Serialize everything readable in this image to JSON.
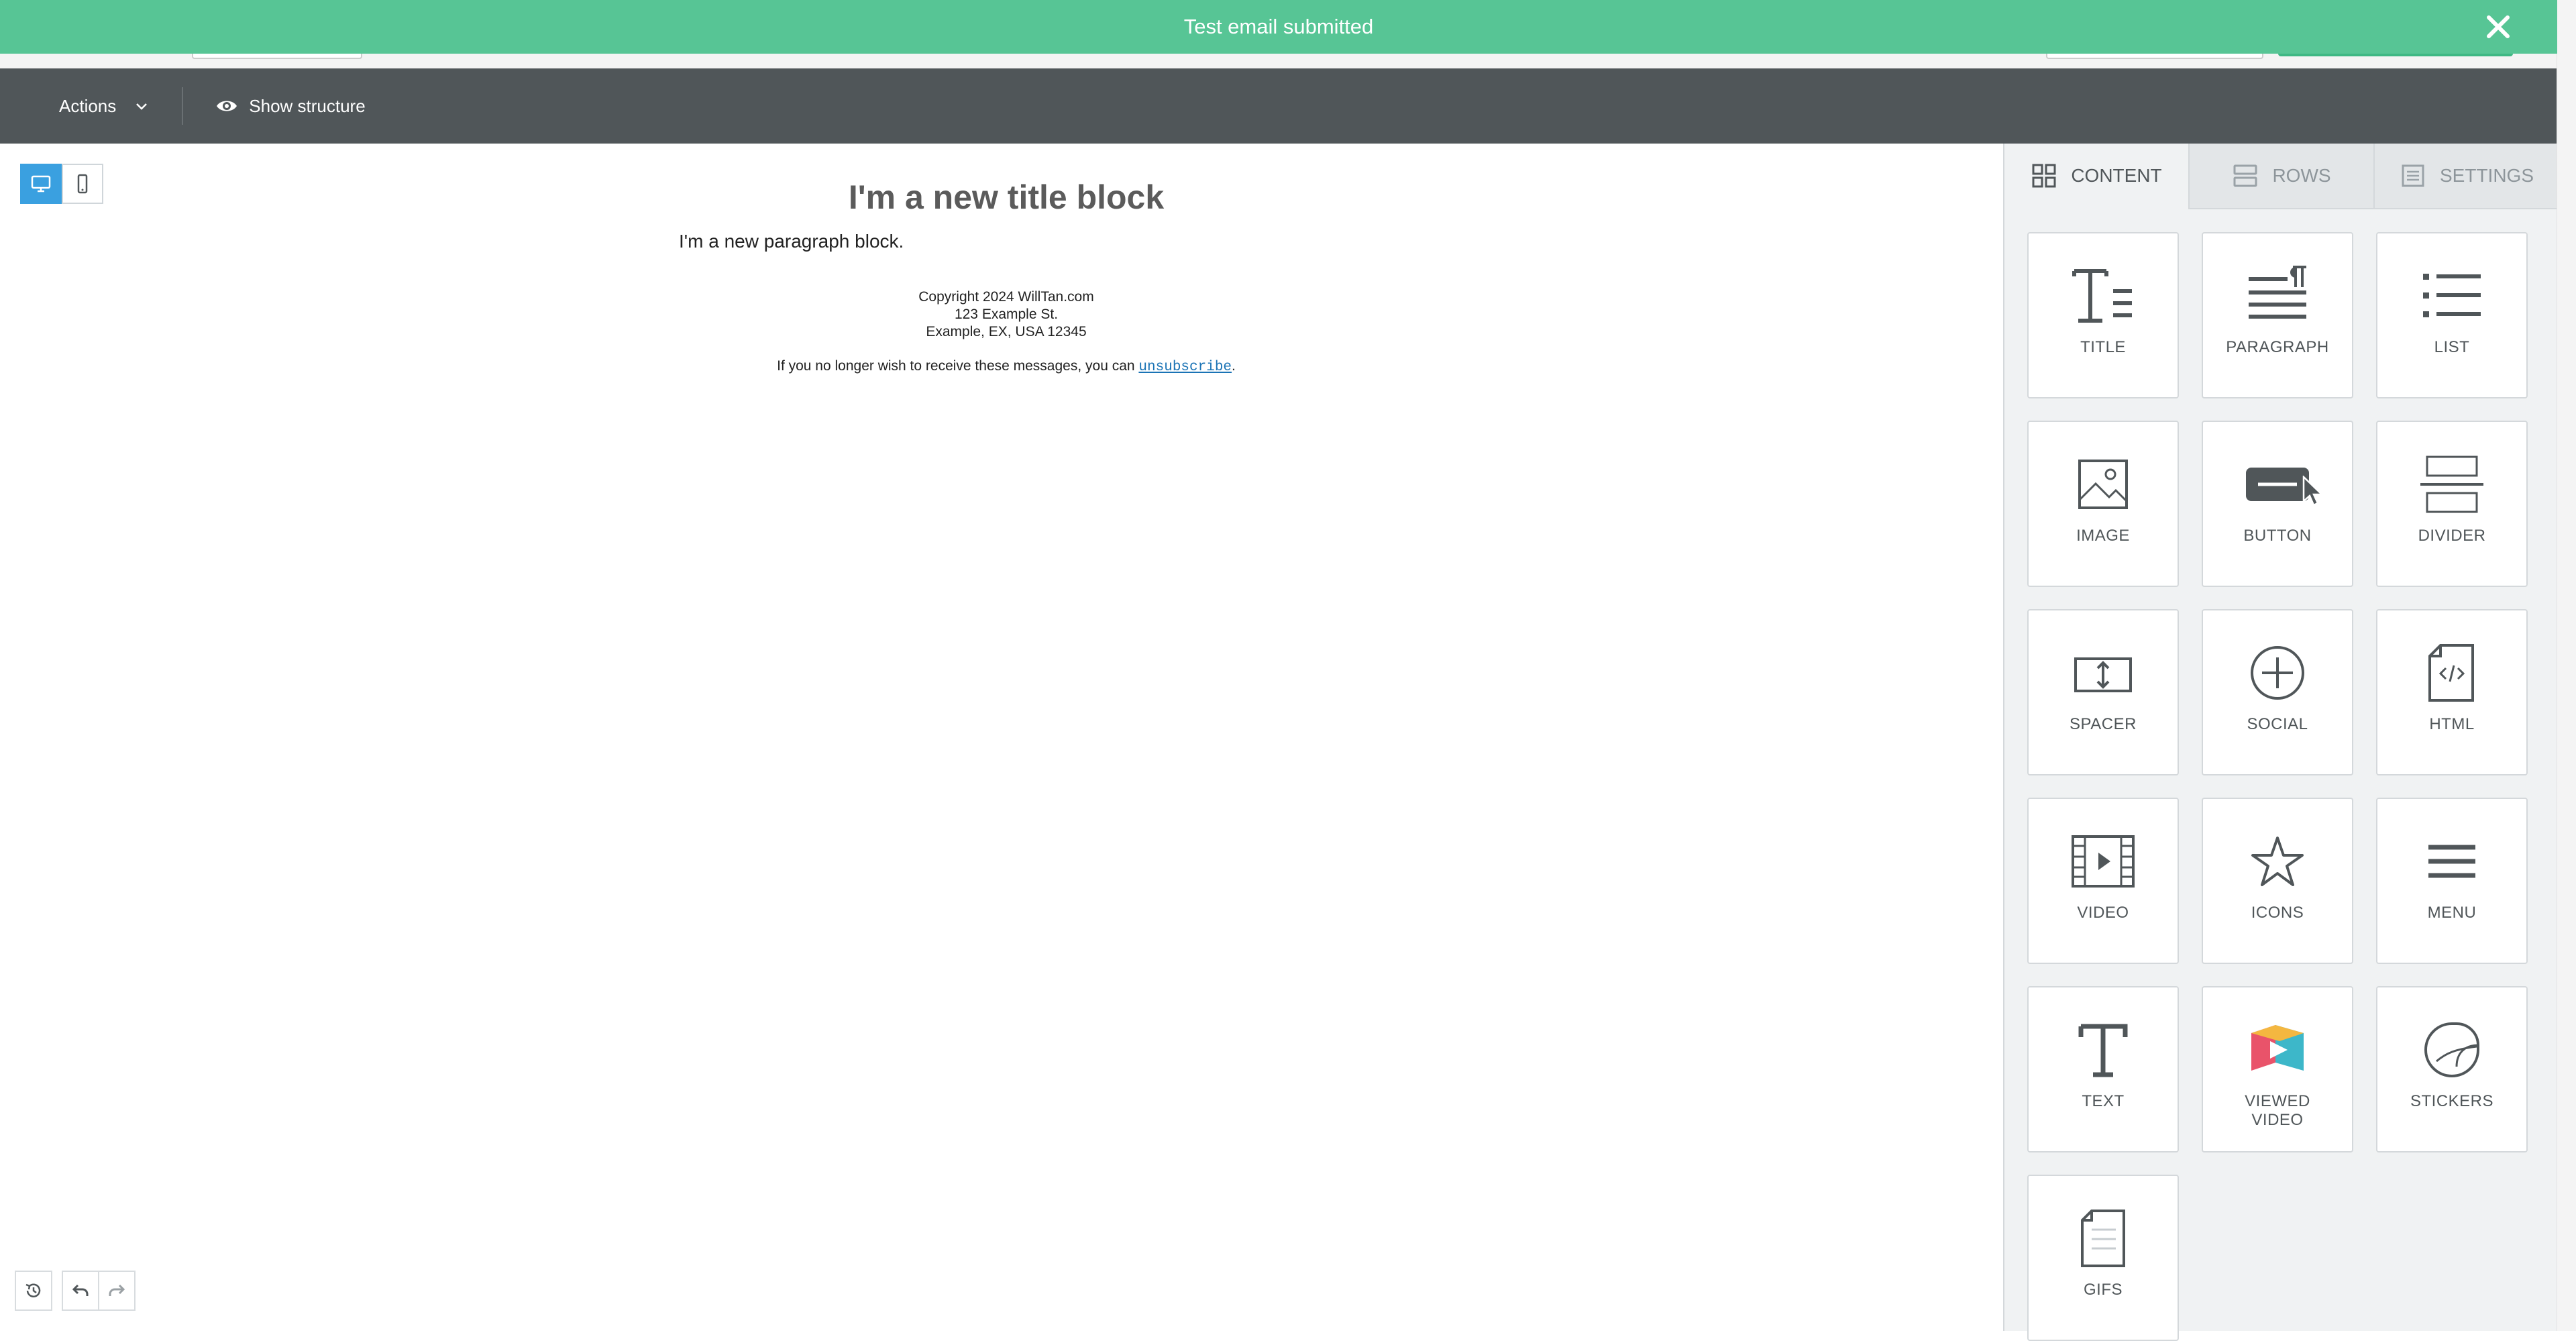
{
  "toast": {
    "message": "Test email submitted",
    "close_icon": "close-icon"
  },
  "actionbar": {
    "actions_label": "Actions",
    "show_structure_label": "Show structure"
  },
  "email": {
    "title": "I'm a new title block",
    "paragraph": "I'm a new paragraph block.",
    "footer_lines": [
      "Copyright 2024 WillTan.com",
      "123 Example St.",
      "Example, EX, USA 12345"
    ],
    "unsub_prefix": "If you no longer wish to receive these messages, you can ",
    "unsub_link": "unsubscribe",
    "unsub_suffix": "."
  },
  "panel": {
    "tabs": [
      {
        "label": "CONTENT",
        "icon": "grid-icon",
        "active": true
      },
      {
        "label": "ROWS",
        "icon": "rows-icon",
        "active": false
      },
      {
        "label": "SETTINGS",
        "icon": "settings-doc-icon",
        "active": false
      }
    ],
    "tiles": [
      {
        "label": "TITLE",
        "icon": "title-icon"
      },
      {
        "label": "PARAGRAPH",
        "icon": "paragraph-icon"
      },
      {
        "label": "LIST",
        "icon": "list-icon"
      },
      {
        "label": "IMAGE",
        "icon": "image-icon"
      },
      {
        "label": "BUTTON",
        "icon": "button-icon"
      },
      {
        "label": "DIVIDER",
        "icon": "divider-icon"
      },
      {
        "label": "SPACER",
        "icon": "spacer-icon"
      },
      {
        "label": "SOCIAL",
        "icon": "social-icon"
      },
      {
        "label": "HTML",
        "icon": "html-icon"
      },
      {
        "label": "VIDEO",
        "icon": "video-icon"
      },
      {
        "label": "ICONS",
        "icon": "star-icon"
      },
      {
        "label": "MENU",
        "icon": "menu-icon"
      },
      {
        "label": "TEXT",
        "icon": "text-icon"
      },
      {
        "label": "VIEWED VIDEO",
        "icon": "viewed-video-icon"
      },
      {
        "label": "STICKERS",
        "icon": "sticker-icon"
      },
      {
        "label": "GIFS",
        "icon": "gif-file-icon"
      }
    ]
  },
  "colors": {
    "toast": "#57c595",
    "actionbar": "#505659",
    "accent": "#3aa0e0",
    "link": "#1a73b5"
  }
}
